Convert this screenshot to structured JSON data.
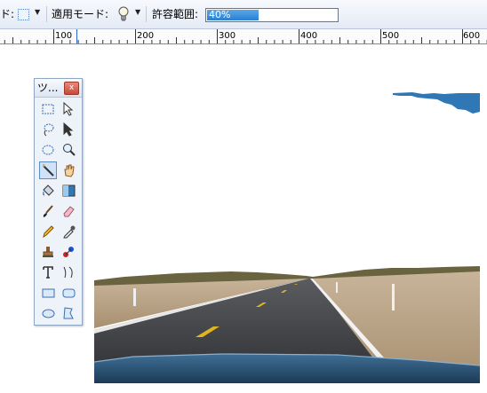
{
  "toolbar": {
    "selection_mode_label": "ド:",
    "flood_mode_label": "適用モード:",
    "tolerance_label": "許容範囲:",
    "tolerance_value": "40%",
    "tolerance_fraction": 0.4
  },
  "ruler": {
    "labels": [
      "100",
      "200",
      "300",
      "400",
      "500",
      "600"
    ]
  },
  "tools_window": {
    "title": "ツ...",
    "close_glyph": "x",
    "tools": [
      {
        "name": "rectangle-select-tool-icon"
      },
      {
        "name": "move-selection-tool-icon"
      },
      {
        "name": "lasso-select-tool-icon"
      },
      {
        "name": "move-selected-pixels-tool-icon"
      },
      {
        "name": "ellipse-select-tool-icon"
      },
      {
        "name": "zoom-tool-icon"
      },
      {
        "name": "magic-wand-tool-icon",
        "active": true
      },
      {
        "name": "pan-tool-icon"
      },
      {
        "name": "paint-bucket-tool-icon"
      },
      {
        "name": "gradient-tool-icon"
      },
      {
        "name": "paintbrush-tool-icon"
      },
      {
        "name": "eraser-tool-icon"
      },
      {
        "name": "pencil-tool-icon"
      },
      {
        "name": "color-picker-tool-icon"
      },
      {
        "name": "clone-stamp-tool-icon"
      },
      {
        "name": "recolor-tool-icon"
      },
      {
        "name": "text-tool-icon"
      },
      {
        "name": "line-curve-tool-icon"
      },
      {
        "name": "rectangle-tool-icon"
      },
      {
        "name": "rounded-rectangle-tool-icon"
      },
      {
        "name": "ellipse-tool-icon"
      },
      {
        "name": "freeform-shape-tool-icon"
      }
    ]
  },
  "colors": {
    "sky_blue": "#2f78b5",
    "road": "#3d3f44",
    "dirt": "#bba58a",
    "center_line": "#e1b51d"
  }
}
